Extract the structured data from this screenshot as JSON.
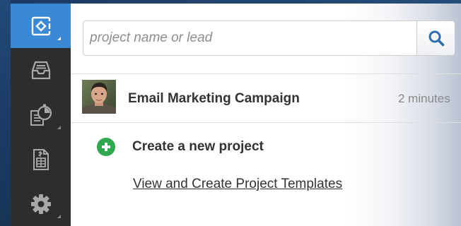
{
  "search": {
    "placeholder": "project name or lead",
    "value": "",
    "button_icon": "search-icon"
  },
  "sidebar": {
    "items": [
      {
        "icon": "project-board-icon",
        "active": true,
        "has_submenu": true
      },
      {
        "icon": "inbox-tray-icon",
        "active": false,
        "has_submenu": false
      },
      {
        "icon": "timesheet-stopwatch-icon",
        "active": false,
        "has_submenu": true
      },
      {
        "icon": "invoice-document-icon",
        "active": false,
        "has_submenu": false
      },
      {
        "icon": "gear-icon",
        "active": false,
        "has_submenu": true
      }
    ]
  },
  "recent_projects": [
    {
      "name": "Email Marketing Campaign",
      "time": "2 minutes"
    }
  ],
  "actions": {
    "create_label": "Create a new project",
    "templates_link": "View and Create Project Templates"
  },
  "colors": {
    "accent": "#3a89d5",
    "sidebar": "#2d2d2d",
    "create_green": "#2fa84f",
    "search_icon": "#2f6ea8"
  }
}
